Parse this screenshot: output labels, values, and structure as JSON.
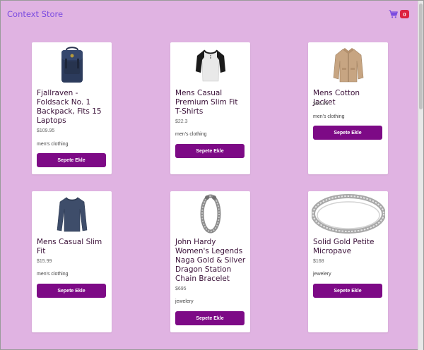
{
  "header": {
    "brand": "Context Store",
    "cart_count": "0"
  },
  "colors": {
    "page_background": "#e0b3e2",
    "brand_text": "#7b4ce0",
    "button": "#7d0a86",
    "badge": "#dc2240"
  },
  "products": [
    {
      "title": "Fjallraven - Foldsack No. 1 Backpack, Fits 15 Laptops",
      "price": "$109.95",
      "category": "men's clothing",
      "button": "Sepete Ekle",
      "icon": "backpack-icon"
    },
    {
      "title": "Mens Casual Premium Slim Fit T-Shirts",
      "price": "$22.3",
      "category": "men's clothing",
      "button": "Sepete Ekle",
      "icon": "tshirt-icon"
    },
    {
      "title": "Mens Cotton Jacket",
      "price": "$55.99",
      "category": "men's clothing",
      "button": "Sepete Ekle",
      "icon": "jacket-icon"
    },
    {
      "title": "Mens Casual Slim Fit",
      "price": "$15.99",
      "category": "men's clothing",
      "button": "Sepete Ekle",
      "icon": "longsleeve-icon"
    },
    {
      "title": "John Hardy Women's Legends Naga Gold & Silver Dragon Station Chain Bracelet",
      "price": "$695",
      "category": "jewelery",
      "button": "Sepete Ekle",
      "icon": "bracelet-icon"
    },
    {
      "title": "Solid Gold Petite Micropave",
      "price": "$168",
      "category": "jewelery",
      "button": "Sepete Ekle",
      "icon": "ring-icon"
    }
  ]
}
